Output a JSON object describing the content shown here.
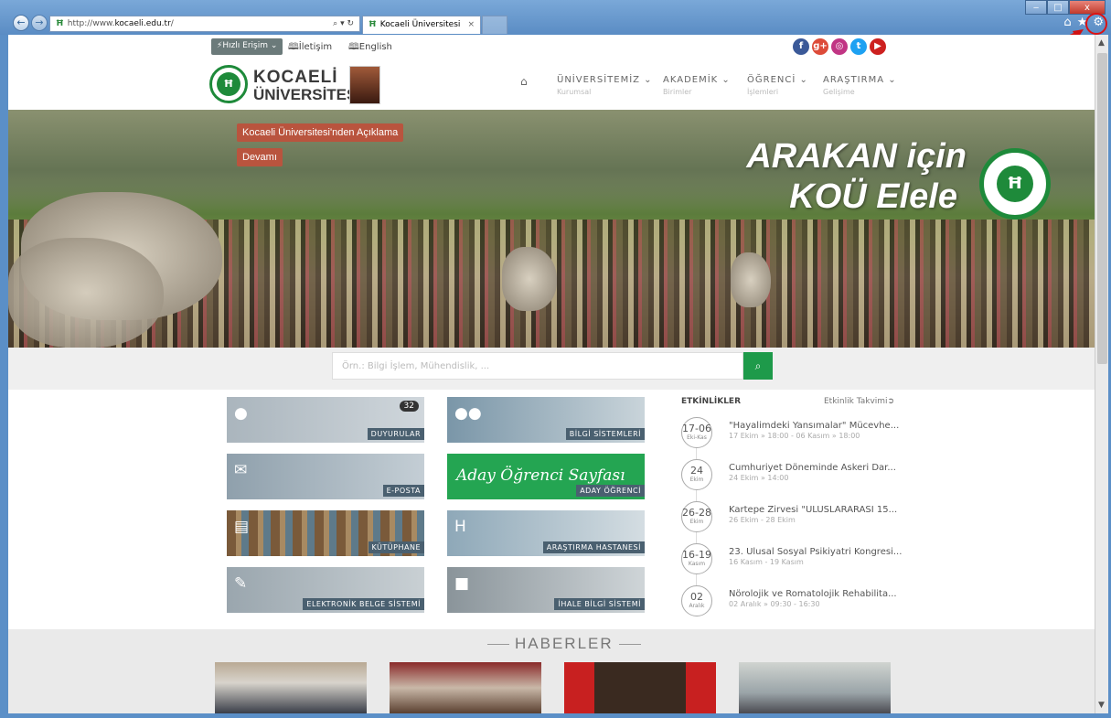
{
  "browser": {
    "url_prefix": "http://www.",
    "url_domain": "kocaeli.edu.tr",
    "url_suffix": "/",
    "address_tools": "⌕ ▾ ↻",
    "favicon": "Ħ",
    "tab_title": "Kocaeli Üniversitesi",
    "tab_close": "×",
    "back_glyph": "←",
    "forward_glyph": "→",
    "controls": [
      "‒",
      "□",
      "x"
    ],
    "tool_icons": [
      "home-icon",
      "star-icon",
      "gear-icon"
    ],
    "annotation_color": "#d11111"
  },
  "topbar": {
    "quick_access": "⚡Hızlı Erişim ⌄",
    "contact": "🕮İletişim",
    "english": "🕮English",
    "social": [
      {
        "name": "facebook",
        "glyph": "f",
        "color": "#3b5998"
      },
      {
        "name": "google-plus",
        "glyph": "g+",
        "color": "#dd4b39"
      },
      {
        "name": "instagram",
        "glyph": "◎",
        "color": "#c13584"
      },
      {
        "name": "twitter",
        "glyph": "t",
        "color": "#1da1f2"
      },
      {
        "name": "youtube",
        "glyph": "▶",
        "color": "#cd201f"
      }
    ]
  },
  "header": {
    "logo_line1": "KOCAELİ",
    "logo_line2": "ÜNİVERSİTESİ",
    "logo_emblem": "Ħ",
    "nav": [
      {
        "label": "ÜNİVERSİTEMİZ ⌄",
        "sub": "Kurumsal"
      },
      {
        "label": "AKADEMİK ⌄",
        "sub": "Birimler"
      },
      {
        "label": "ÖĞRENCİ ⌄",
        "sub": "İşlemleri"
      },
      {
        "label": "ARAŞTIRMA ⌄",
        "sub": "Gelişime"
      }
    ]
  },
  "banner": {
    "announcement": "Kocaeli Üniversitesi'nden Açıklama",
    "more": "Devamı",
    "title_line1": "ARAKAN için",
    "title_line2": "KOÜ Elele",
    "emblem": "Ħ"
  },
  "search": {
    "placeholder": "Örn.: Bilgi İşlem, Mühendislik, ...",
    "button": "⌕"
  },
  "tiles": [
    {
      "label": "DUYURULAR",
      "badge": "32",
      "icon": "comments-icon",
      "glyph": "💬"
    },
    {
      "label": "BİLGİ SİSTEMLERİ",
      "icon": "users-icon",
      "glyph": "👥"
    },
    {
      "label": "E-POSTA",
      "icon": "envelope-icon",
      "glyph": "✉"
    },
    {
      "label": "ADAY ÖĞRENCİ",
      "icon": "student-icon",
      "glyph": "",
      "overlay": "Aday Öğrenci Sayfası"
    },
    {
      "label": "KÜTÜPHANE",
      "icon": "book-icon",
      "glyph": "📖"
    },
    {
      "label": "ARAŞTIRMA HASTANESİ",
      "icon": "hospital-icon",
      "glyph": "H"
    },
    {
      "label": "ELEKTRONİK BELGE SİSTEMİ",
      "icon": "edit-icon",
      "glyph": "✎"
    },
    {
      "label": "İHALE BİLGİ SİSTEMİ",
      "icon": "briefcase-icon",
      "glyph": "💼"
    }
  ],
  "events": {
    "heading": "ETKİNLİKLER",
    "calendar_link": "Etkinlik Takvimi➲",
    "items": [
      {
        "day": "17-06",
        "month": "Eki-Kas",
        "title": "\"Hayalimdeki Yansımalar\" Mücevhe...",
        "time": "17 Ekim » 18:00 - 06 Kasım » 18:00"
      },
      {
        "day": "24",
        "month": "Ekim",
        "title": "Cumhuriyet Döneminde Askeri Dar...",
        "time": "24 Ekim » 14:00"
      },
      {
        "day": "26-28",
        "month": "Ekim",
        "title": "Kartepe Zirvesi \"ULUSLARARASI 15...",
        "time": "26 Ekim - 28 Ekim"
      },
      {
        "day": "16-19",
        "month": "Kasım",
        "title": "23. Ulusal Sosyal Psikiyatri Kongresi...",
        "time": "16 Kasım - 19 Kasım"
      },
      {
        "day": "02",
        "month": "Aralık",
        "title": "Nörolojik ve Romatolojik Rehabilita...",
        "time": "02 Aralık » 09:30 - 16:30"
      }
    ]
  },
  "news": {
    "heading": "HABERLER",
    "images": [
      "Meeting room with presentation screen",
      "Two women in front of poster",
      "Officials with Turkish flags",
      "Presentation on projector screen"
    ]
  }
}
